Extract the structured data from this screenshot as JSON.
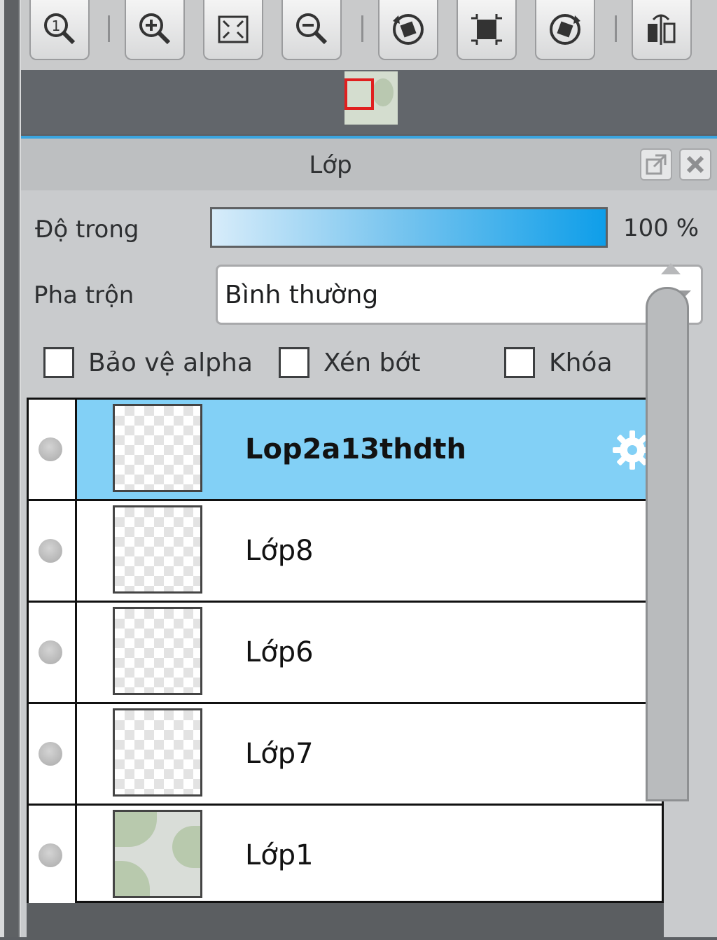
{
  "toolbar": {
    "buttons": [
      {
        "name": "zoom-actual-icon"
      },
      {
        "name": "zoom-in-icon"
      },
      {
        "name": "fit-screen-icon"
      },
      {
        "name": "zoom-out-icon"
      },
      {
        "name": "rotate-left-icon"
      },
      {
        "name": "crop-icon"
      },
      {
        "name": "rotate-right-icon"
      },
      {
        "name": "flip-horizontal-icon"
      }
    ]
  },
  "panel": {
    "title": "Lớp",
    "opacity_label": "Độ trong",
    "opacity_value": "100 %",
    "opacity_fraction": 1.0,
    "blend_label": "Pha trộn",
    "blend_value": "Bình thường",
    "checkboxes": [
      {
        "label": "Bảo vệ alpha",
        "checked": false
      },
      {
        "label": "Xén bớt",
        "checked": false
      },
      {
        "label": "Khóa",
        "checked": false
      }
    ]
  },
  "layers": [
    {
      "name": "Lop2a13thdth",
      "selected": true
    },
    {
      "name": "Lớp8",
      "selected": false
    },
    {
      "name": "Lớp6",
      "selected": false
    },
    {
      "name": "Lớp7",
      "selected": false
    },
    {
      "name": "Lớp1",
      "selected": false
    }
  ],
  "colors": {
    "accent": "#3aa5e0",
    "selected_row": "#82d0f6",
    "navigator_frame": "#e01f1f"
  }
}
